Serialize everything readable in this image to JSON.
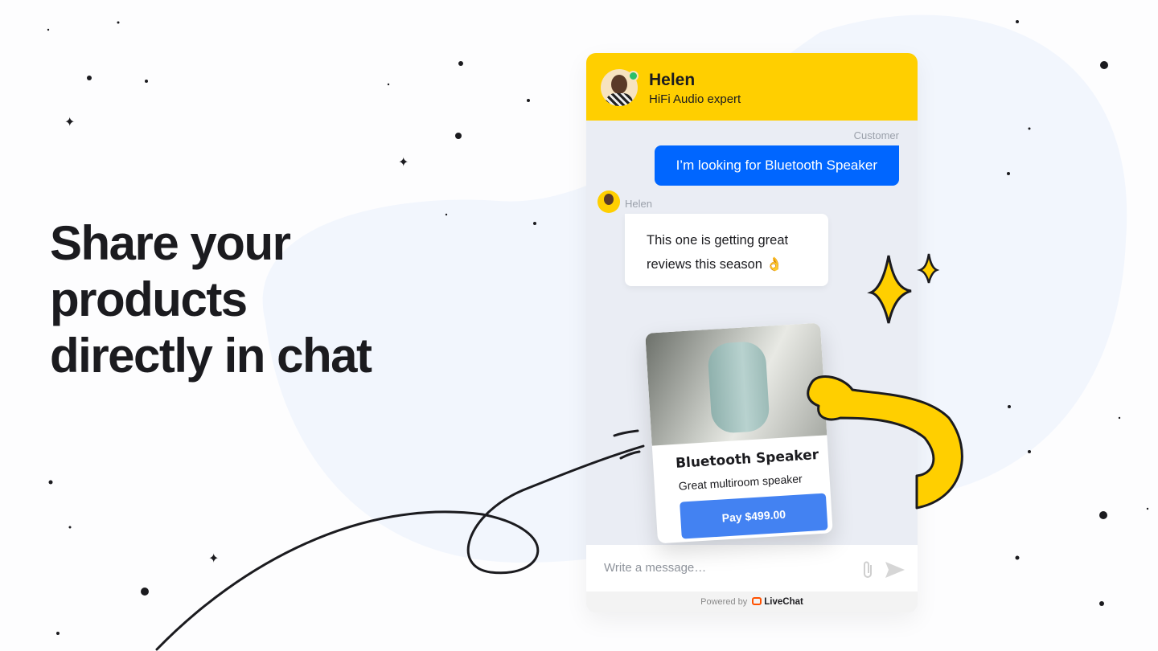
{
  "headline": [
    "Share your",
    "products",
    "directly in chat"
  ],
  "chat": {
    "agent_name": "Helen",
    "agent_role": "HiFi Audio expert",
    "customer_label": "Customer",
    "customer_message": "I’m looking for Bluetooth Speaker",
    "agent_label": "Helen",
    "agent_message": "This one is getting great reviews this season 👌",
    "product": {
      "title": "Bluetooth Speaker",
      "description": "Great multiroom speaker",
      "pay_label": "Pay $499.00"
    },
    "input_placeholder": "Write a message…",
    "powered_by": "Powered by",
    "brand": "LiveChat"
  },
  "colors": {
    "header": "#ffcf00",
    "customer_bubble": "#0066ff",
    "pay_button": "#4382f2",
    "online": "#2bbf6a"
  }
}
